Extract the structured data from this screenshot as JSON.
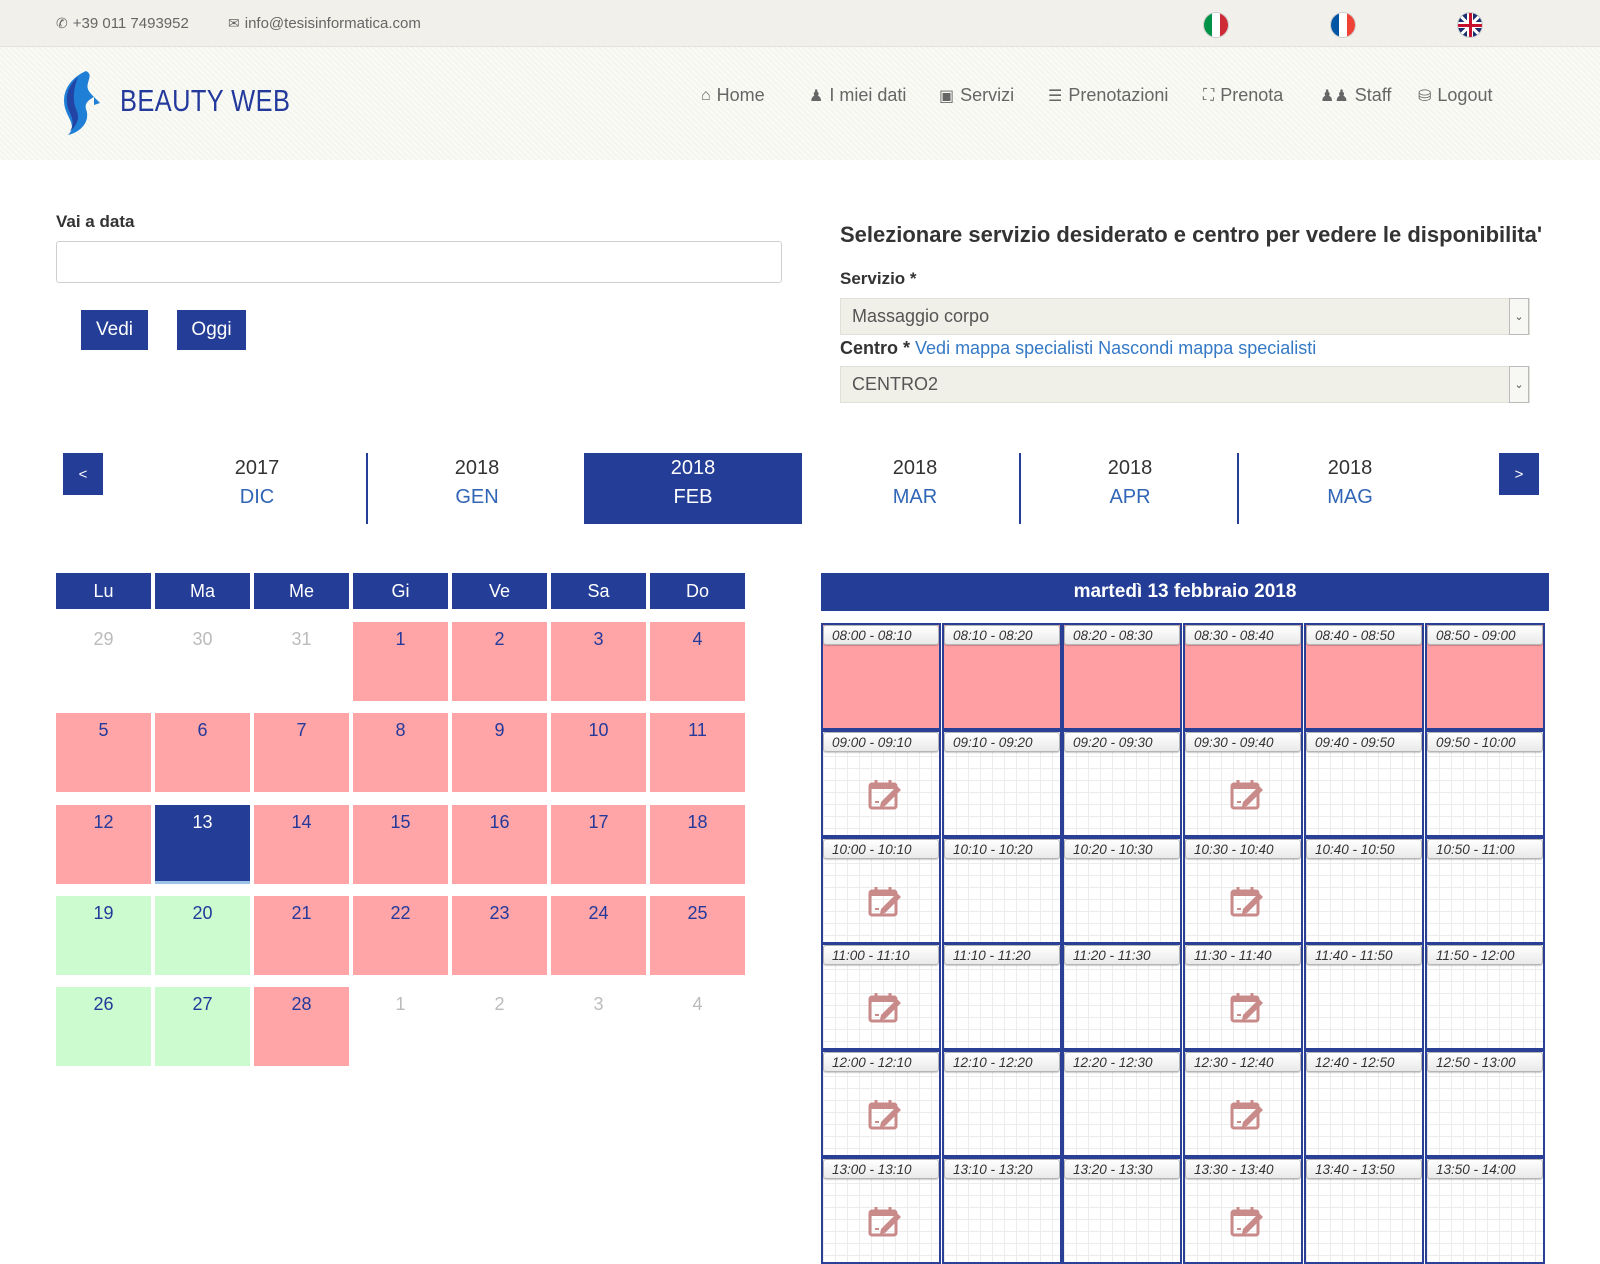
{
  "topbar": {
    "phone": "+39 011 7493952",
    "email": "info@tesisinformatica.com",
    "flags": [
      {
        "name": "italian-flag-icon",
        "colors": [
          "#009246",
          "#ffffff",
          "#ce2b37"
        ]
      },
      {
        "name": "french-flag-icon",
        "colors": [
          "#0055a4",
          "#ffffff",
          "#ef4135"
        ]
      },
      {
        "name": "uk-flag-icon",
        "colors": [
          "#1b2f73",
          "#ffffff",
          "#c8102e"
        ]
      }
    ]
  },
  "header": {
    "brand": "BEAUTY WEB",
    "nav": [
      {
        "label": "Home",
        "icon": "home-icon"
      },
      {
        "label": "I miei dati",
        "icon": "user-icon"
      },
      {
        "label": "Servizi",
        "icon": "bag-icon"
      },
      {
        "label": "Prenotazioni",
        "icon": "list-icon"
      },
      {
        "label": "Prenota",
        "icon": "cart-icon"
      },
      {
        "label": "Staff",
        "icon": "group-icon"
      },
      {
        "label": "Logout",
        "icon": "lock-icon"
      }
    ]
  },
  "goto": {
    "label": "Vai a data",
    "value": "",
    "vedi": "Vedi",
    "oggi": "Oggi"
  },
  "selection": {
    "title": "Selezionare servizio desiderato e centro per vedere le disponibilita'",
    "servizio_label": "Servizio *",
    "servizio_value": "Massaggio corpo",
    "centro_label": "Centro *",
    "vedi_mappa": "Vedi mappa specialisti",
    "nascondi_mappa": "Nascondi mappa specialisti",
    "centro_value": "CENTRO2"
  },
  "months": {
    "prev": "<",
    "next": ">",
    "items": [
      {
        "year": "2017",
        "month": "DIC"
      },
      {
        "year": "2018",
        "month": "GEN"
      },
      {
        "year": "2018",
        "month": "FEB",
        "active": true
      },
      {
        "year": "2018",
        "month": "MAR"
      },
      {
        "year": "2018",
        "month": "APR"
      },
      {
        "year": "2018",
        "month": "MAG"
      }
    ]
  },
  "calendar": {
    "weekdays": [
      "Lu",
      "Ma",
      "Me",
      "Gi",
      "Ve",
      "Sa",
      "Do"
    ],
    "weeks": [
      [
        {
          "d": "29",
          "s": "other"
        },
        {
          "d": "30",
          "s": "other"
        },
        {
          "d": "31",
          "s": "other"
        },
        {
          "d": "1",
          "s": "booked"
        },
        {
          "d": "2",
          "s": "booked"
        },
        {
          "d": "3",
          "s": "booked"
        },
        {
          "d": "4",
          "s": "booked"
        }
      ],
      [
        {
          "d": "5",
          "s": "booked"
        },
        {
          "d": "6",
          "s": "booked"
        },
        {
          "d": "7",
          "s": "booked"
        },
        {
          "d": "8",
          "s": "booked"
        },
        {
          "d": "9",
          "s": "booked"
        },
        {
          "d": "10",
          "s": "booked"
        },
        {
          "d": "11",
          "s": "booked"
        }
      ],
      [
        {
          "d": "12",
          "s": "booked"
        },
        {
          "d": "13",
          "s": "sel"
        },
        {
          "d": "14",
          "s": "booked"
        },
        {
          "d": "15",
          "s": "booked"
        },
        {
          "d": "16",
          "s": "booked"
        },
        {
          "d": "17",
          "s": "booked"
        },
        {
          "d": "18",
          "s": "booked"
        }
      ],
      [
        {
          "d": "19",
          "s": "free"
        },
        {
          "d": "20",
          "s": "free"
        },
        {
          "d": "21",
          "s": "booked"
        },
        {
          "d": "22",
          "s": "booked"
        },
        {
          "d": "23",
          "s": "booked"
        },
        {
          "d": "24",
          "s": "booked"
        },
        {
          "d": "25",
          "s": "booked"
        }
      ],
      [
        {
          "d": "26",
          "s": "free"
        },
        {
          "d": "27",
          "s": "free"
        },
        {
          "d": "28",
          "s": "booked"
        },
        {
          "d": "1",
          "s": "other"
        },
        {
          "d": "2",
          "s": "other"
        },
        {
          "d": "3",
          "s": "other"
        },
        {
          "d": "4",
          "s": "other"
        }
      ]
    ],
    "colors": {
      "booked": "#ffa5a8",
      "free": "#ccfbcf",
      "selected": "#243d96"
    }
  },
  "schedule": {
    "title": "martedì 13 febbraio 2018",
    "rows": [
      [
        {
          "t": "08:00 - 08:10",
          "s": "busy"
        },
        {
          "t": "08:10 - 08:20",
          "s": "busy"
        },
        {
          "t": "08:20 - 08:30",
          "s": "busy"
        },
        {
          "t": "08:30 - 08:40",
          "s": "busy"
        },
        {
          "t": "08:40 - 08:50",
          "s": "busy"
        },
        {
          "t": "08:50 - 09:00",
          "s": "busy"
        }
      ],
      [
        {
          "t": "09:00 - 09:10",
          "s": "book"
        },
        {
          "t": "09:10 - 09:20",
          "s": "empty"
        },
        {
          "t": "09:20 - 09:30",
          "s": "empty"
        },
        {
          "t": "09:30 - 09:40",
          "s": "book"
        },
        {
          "t": "09:40 - 09:50",
          "s": "empty"
        },
        {
          "t": "09:50 - 10:00",
          "s": "empty"
        }
      ],
      [
        {
          "t": "10:00 - 10:10",
          "s": "book"
        },
        {
          "t": "10:10 - 10:20",
          "s": "empty"
        },
        {
          "t": "10:20 - 10:30",
          "s": "empty"
        },
        {
          "t": "10:30 - 10:40",
          "s": "book"
        },
        {
          "t": "10:40 - 10:50",
          "s": "empty"
        },
        {
          "t": "10:50 - 11:00",
          "s": "empty"
        }
      ],
      [
        {
          "t": "11:00 - 11:10",
          "s": "book"
        },
        {
          "t": "11:10 - 11:20",
          "s": "empty"
        },
        {
          "t": "11:20 - 11:30",
          "s": "empty"
        },
        {
          "t": "11:30 - 11:40",
          "s": "book"
        },
        {
          "t": "11:40 - 11:50",
          "s": "empty"
        },
        {
          "t": "11:50 - 12:00",
          "s": "empty"
        }
      ],
      [
        {
          "t": "12:00 - 12:10",
          "s": "book"
        },
        {
          "t": "12:10 - 12:20",
          "s": "empty"
        },
        {
          "t": "12:20 - 12:30",
          "s": "empty"
        },
        {
          "t": "12:30 - 12:40",
          "s": "book"
        },
        {
          "t": "12:40 - 12:50",
          "s": "empty"
        },
        {
          "t": "12:50 - 13:00",
          "s": "empty"
        }
      ],
      [
        {
          "t": "13:00 - 13:10",
          "s": "book"
        },
        {
          "t": "13:10 - 13:20",
          "s": "empty"
        },
        {
          "t": "13:20 - 13:30",
          "s": "empty"
        },
        {
          "t": "13:30 - 13:40",
          "s": "book"
        },
        {
          "t": "13:40 - 13:50",
          "s": "empty"
        },
        {
          "t": "13:50 - 14:00",
          "s": "empty"
        }
      ]
    ],
    "book_icon": "calendar-edit-icon"
  },
  "accent": "#243d96"
}
